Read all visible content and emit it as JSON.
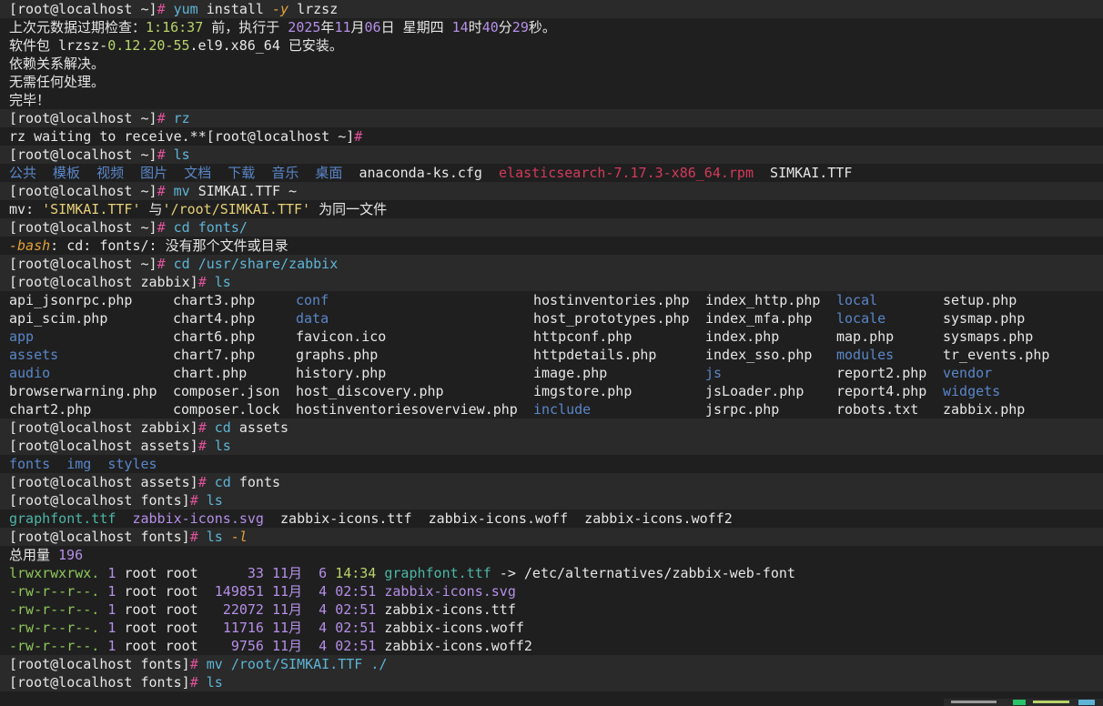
{
  "prompts": {
    "home": "[root@localhost ~]",
    "zabbix": "[root@localhost zabbix]",
    "assets": "[root@localhost assets]",
    "fonts": "[root@localhost fonts]",
    "hash": "#"
  },
  "yum": {
    "cmd": "yum",
    "args1": " install ",
    "flag": "-y",
    "args2": " lrzsz",
    "meta_prefix": "上次元数据过期检查：",
    "meta_time": "1:16:37",
    "meta_mid": " 前，执行于 ",
    "meta_year": "2025",
    "meta_y": "年",
    "meta_month": "11",
    "meta_m": "月",
    "meta_day": "06",
    "meta_d": "日 星期四 ",
    "meta_hour": "14",
    "meta_h": "时",
    "meta_min": "40",
    "meta_mi": "分",
    "meta_sec": "29",
    "meta_s": "秒。",
    "installed_prefix": "软件包 lrzsz-",
    "installed_ver": "0.12.20-55",
    "installed_suffix": ".el9.x86_64 已安装。",
    "deps": "依赖关系解决。",
    "nothing": "无需任何处理。",
    "done": "完毕！"
  },
  "rz": {
    "cmd": "rz",
    "output": "rz waiting to receive.**[root@localhost ~]",
    "output_hash": "#"
  },
  "ls_home": {
    "cmd": "ls",
    "dirs": "公共  模板  视频  图片  文档  下载  音乐  桌面",
    "file1": "  anaconda-ks.cfg  ",
    "rpm": "elasticsearch-7.17.3-x86_64.rpm",
    "file2": "  SIMKAI.TTF"
  },
  "mv1": {
    "cmd": "mv",
    "args": " SIMKAI.TTF ~",
    "err_cmd": "mv",
    "err_colon": ": ",
    "src": "'SIMKAI.TTF'",
    "mid": " 与",
    "dst": "'/root/SIMKAI.TTF'",
    "tail": " 为同一文件"
  },
  "cd_fonts": {
    "cmd": "cd",
    "args": " fonts/",
    "err_bash": "-bash",
    "err_rest": ": cd: fonts/: 没有那个文件或目录"
  },
  "cd_zabbix": {
    "cmd": "cd",
    "args": " /usr/share/zabbix"
  },
  "ls_zabbix": {
    "cmd": "ls",
    "rows": [
      [
        "api_jsonrpc.php",
        "chart3.php",
        "conf",
        "hostinventories.php",
        "index_http.php",
        "local",
        "setup.php"
      ],
      [
        "api_scim.php",
        "chart4.php",
        "data",
        "host_prototypes.php",
        "index_mfa.php",
        "locale",
        "sysmap.php"
      ],
      [
        "app",
        "chart6.php",
        "favicon.ico",
        "httpconf.php",
        "index.php",
        "map.php",
        "sysmaps.php"
      ],
      [
        "assets",
        "chart7.php",
        "graphs.php",
        "httpdetails.php",
        "index_sso.php",
        "modules",
        "tr_events.php"
      ],
      [
        "audio",
        "chart.php",
        "history.php",
        "image.php",
        "js",
        "report2.php",
        "vendor"
      ],
      [
        "browserwarning.php",
        "composer.json",
        "host_discovery.php",
        "imgstore.php",
        "jsLoader.php",
        "report4.php",
        "widgets"
      ],
      [
        "chart2.php",
        "composer.lock",
        "hostinventoriesoverview.php",
        "include",
        "jsrpc.php",
        "robots.txt",
        "zabbix.php"
      ]
    ],
    "dirs": [
      "conf",
      "local",
      "data",
      "locale",
      "app",
      "assets",
      "modules",
      "audio",
      "js",
      "vendor",
      "widgets",
      "include"
    ]
  },
  "cd_assets": {
    "cmd": "cd",
    "args": " assets"
  },
  "ls_assets": {
    "cmd": "ls",
    "output": "fonts  img  styles"
  },
  "cd_fonts2": {
    "cmd": "cd",
    "args": " fonts"
  },
  "ls_fonts": {
    "cmd": "ls",
    "link": "graphfont.ttf",
    "svg": "zabbix-icons.svg",
    "rest": "  zabbix-icons.ttf  zabbix-icons.woff  zabbix-icons.woff2"
  },
  "ls_l": {
    "cmd": "ls",
    "flag": "-l",
    "total_label": "总用量 ",
    "total": "196",
    "entries": [
      {
        "perm": "lrwxrwxrwx.",
        "links": "1",
        "owner": "root root",
        "size": "33",
        "month": "11月",
        "day": "6",
        "time": "14:34",
        "name": "graphfont.ttf",
        "arrow": " -> ",
        "target": "/etc/alternatives/zabbix-web-font",
        "kind": "link"
      },
      {
        "perm": "-rw-r--r--.",
        "links": "1",
        "owner": "root root",
        "size": "149851",
        "month": "11月",
        "day": "4",
        "time": "02:51",
        "name": "zabbix-icons.svg",
        "kind": "svg"
      },
      {
        "perm": "-rw-r--r--.",
        "links": "1",
        "owner": "root root",
        "size": "22072",
        "month": "11月",
        "day": "4",
        "time": "02:51",
        "name": "zabbix-icons.ttf",
        "kind": "file"
      },
      {
        "perm": "-rw-r--r--.",
        "links": "1",
        "owner": "root root",
        "size": "11716",
        "month": "11月",
        "day": "4",
        "time": "02:51",
        "name": "zabbix-icons.woff",
        "kind": "file"
      },
      {
        "perm": "-rw-r--r--.",
        "links": "1",
        "owner": "root root",
        "size": "9756",
        "month": "11月",
        "day": "4",
        "time": "02:51",
        "name": "zabbix-icons.woff2",
        "kind": "file"
      }
    ]
  },
  "mv2": {
    "cmd": "mv",
    "args": " /root/SIMKAI.TTF ./"
  },
  "ls_last": {
    "cmd": "ls"
  },
  "colors": {
    "background": "#1f1f1f",
    "prompt_hash": "#e0529a",
    "command": "#5eb4d6",
    "directory": "#5a86c9",
    "rpm_file": "#d33a5a",
    "symlink": "#4db6a7",
    "svg_file": "#b58fe8"
  }
}
